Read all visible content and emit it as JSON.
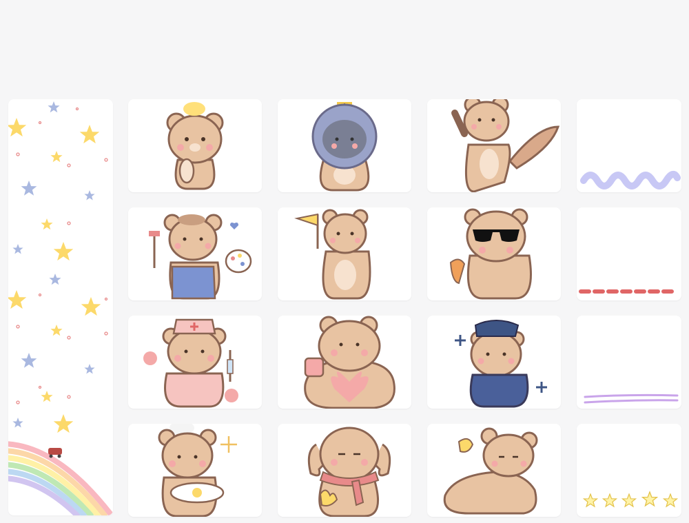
{
  "layout": {
    "columns": 4,
    "rows": 4
  },
  "side_panel": {
    "theme": "stars-and-rainbow"
  },
  "stickers": [
    [
      "bear-eating-bread-icon",
      "bear-in-space-helmet-icon",
      "bear-waving-with-squirrel-tail-icon",
      "wavy-line-divider-icon"
    ],
    [
      "bear-painter-icon",
      "bear-holding-flag-icon",
      "bear-in-sunglasses-icon",
      "dashed-line-divider-icon"
    ],
    [
      "bear-nurse-icon",
      "bear-with-heart-and-mug-icon",
      "bear-police-officer-icon",
      "double-line-divider-icon"
    ],
    [
      "bear-chef-with-egg-icon",
      "puppy-bear-with-scarf-icon",
      "bear-lying-down-icon",
      "stars-row-divider-icon"
    ]
  ],
  "colors": {
    "bear_body": "#e8c3a2",
    "bear_outline": "#8a6452",
    "bear_belly": "#f7e2cf",
    "cheek": "#f4a9a8",
    "star_yellow": "#fcd96a",
    "star_blue": "#a9b8e0",
    "divider_lilac": "#c8c8f5",
    "divider_red": "#e06666",
    "divider_purple": "#c9a4ea"
  }
}
